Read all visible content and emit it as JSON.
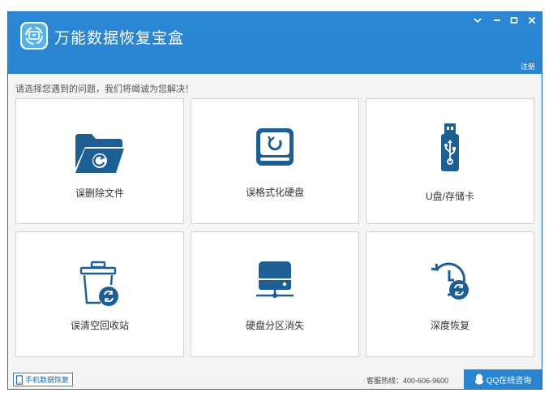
{
  "window": {
    "title": "万能数据恢复宝盒",
    "controls": {
      "menu": "menu",
      "minimize": "minimize",
      "maximize": "maximize",
      "close": "close"
    },
    "register_label": "注册"
  },
  "hint": "请选择您遇到的问题，我们将竭诚为您解决！",
  "cards": [
    {
      "label": "误删除文件",
      "icon": "folder-restore-icon"
    },
    {
      "label": "误格式化硬盘",
      "icon": "disk-restore-icon"
    },
    {
      "label": "U盘/存储卡",
      "icon": "usb-drive-icon"
    },
    {
      "label": "误清空回收站",
      "icon": "recycle-bin-restore-icon"
    },
    {
      "label": "硬盘分区消失",
      "icon": "hard-disk-partition-icon"
    },
    {
      "label": "深度恢复",
      "icon": "deep-recovery-clock-icon"
    }
  ],
  "footer": {
    "phone_recovery_label": "手机数据恢复",
    "hotline": "客服热线：400-606-9600",
    "qq_label": "QQ在线咨询"
  },
  "colors": {
    "brand": "#2a84d0",
    "icon": "#1d5f94",
    "background": "#f4f4f4"
  }
}
